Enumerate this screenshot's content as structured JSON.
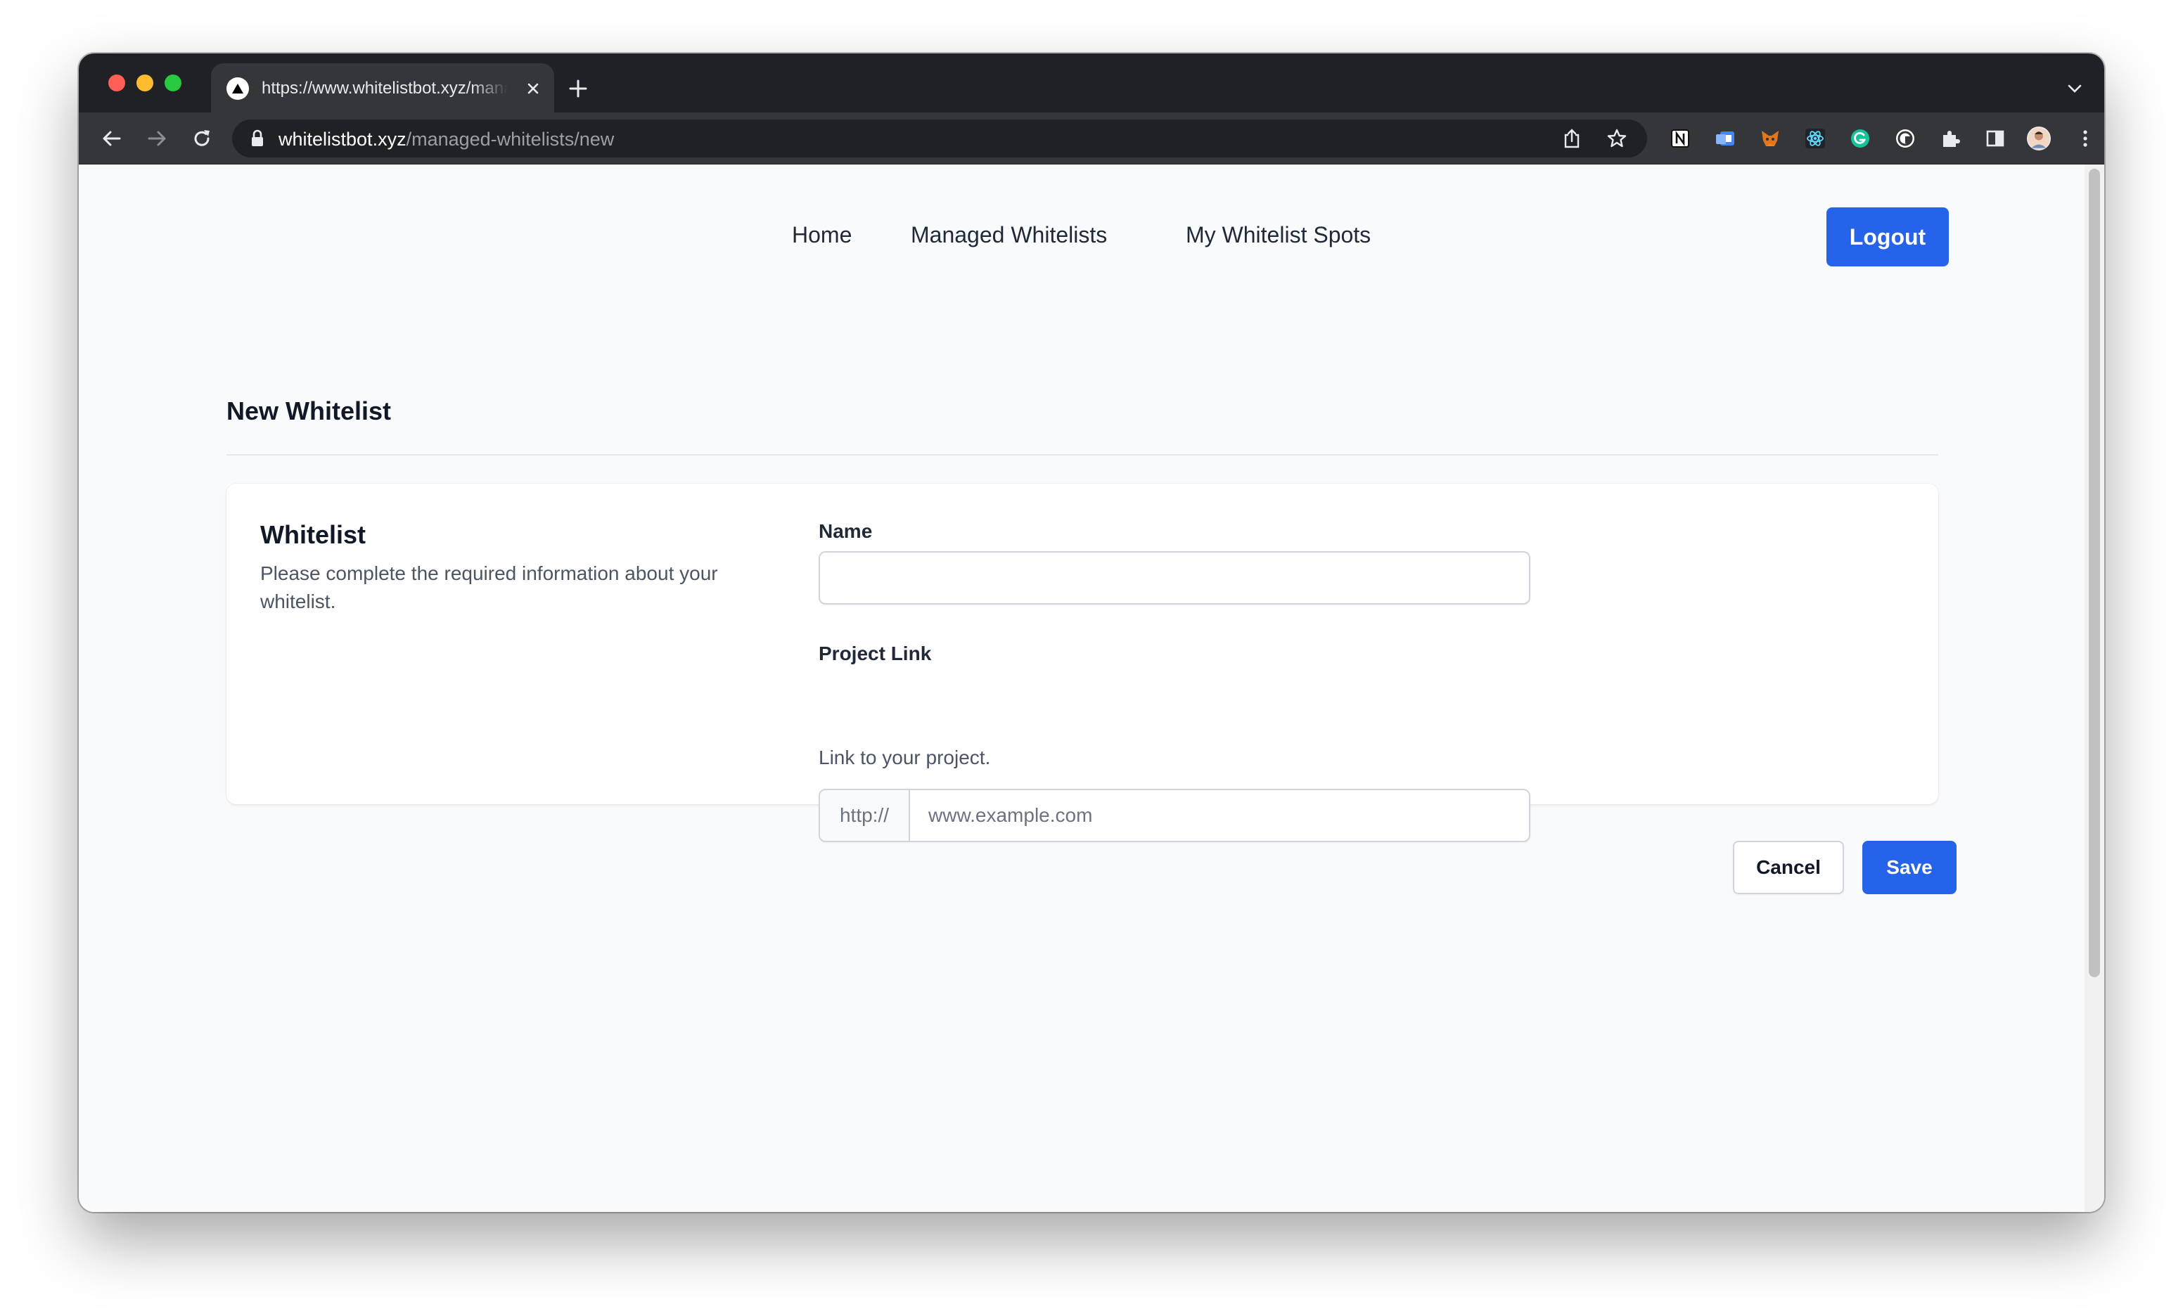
{
  "browser": {
    "tab_title": "https://www.whitelistbot.xyz/managed-whitelists/new",
    "url_host": "whitelistbot.xyz",
    "url_path": "/managed-whitelists/new"
  },
  "nav": {
    "links": [
      {
        "label": "Home"
      },
      {
        "label": "Managed Whitelists"
      },
      {
        "label": "My Whitelist Spots"
      }
    ],
    "logout_label": "Logout"
  },
  "page": {
    "title": "New Whitelist"
  },
  "form": {
    "section_title": "Whitelist",
    "section_description": "Please complete the required information about your whitelist.",
    "name_label": "Name",
    "name_value": "",
    "project_link_label": "Project Link",
    "project_link_prefix": "http://",
    "project_link_placeholder": "www.example.com",
    "project_link_help": "Link to your project.",
    "cancel_label": "Cancel",
    "save_label": "Save"
  },
  "colors": {
    "primary": "#2563eb",
    "browser_frame": "#202124",
    "browser_toolbar": "#35363a",
    "page_background": "#f9fafb"
  }
}
